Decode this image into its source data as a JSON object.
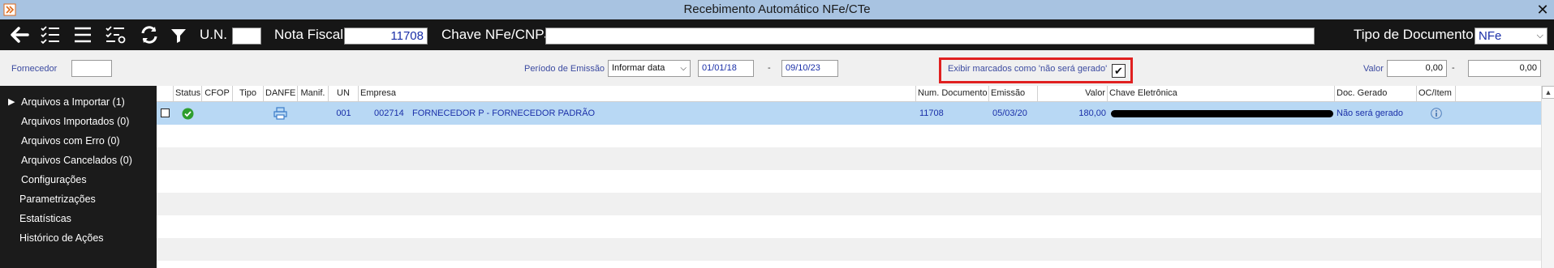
{
  "window": {
    "title": "Recebimento Automático NFe/CTe",
    "close_glyph": "✕"
  },
  "toolbar": {
    "un_label": "U.N.",
    "un_value": "",
    "nota_fiscal_label": "Nota Fiscal",
    "nota_fiscal_value": "11708",
    "chave_label": "Chave NFe/CNPJ",
    "chave_value": "",
    "tipo_doc_label": "Tipo de Documento",
    "tipo_doc_value": "NFe"
  },
  "filters": {
    "fornecedor_label": "Fornecedor",
    "fornecedor_value": "",
    "periodo_label": "Período de Emissão",
    "periodo_option": "Informar data",
    "date_from": "01/01/18",
    "date_sep": "-",
    "date_to": "09/10/23",
    "exibir_label": "Exibir marcados como 'não será gerado'",
    "exibir_checked": true,
    "valor_label": "Valor",
    "valor_from": "0,00",
    "valor_sep": "-",
    "valor_to": "0,00"
  },
  "sidebar": {
    "items": [
      {
        "label": "Arquivos a Importar (1)",
        "expanded": true
      },
      {
        "label": "Arquivos Importados (0)"
      },
      {
        "label": "Arquivos com Erro (0)"
      },
      {
        "label": "Arquivos Cancelados (0)"
      },
      {
        "label": "Configurações"
      },
      {
        "label": "Parametrizações"
      },
      {
        "label": "Estatísticas"
      },
      {
        "label": "Histórico de Ações"
      }
    ]
  },
  "grid": {
    "columns": [
      "Status",
      "CFOP",
      "Tipo",
      "DANFE",
      "Manif.",
      "UN",
      "Empresa",
      "Num. Documento",
      "Emissão",
      "Valor",
      "Chave Eletrônica",
      "Doc. Gerado",
      "OC/Item"
    ],
    "rows": [
      {
        "status": "ok",
        "cfop": "",
        "tipo": "",
        "manif": "",
        "un": "001",
        "empresa_code": "002714",
        "empresa_name": "FORNECEDOR P - FORNECEDOR PADRÃO",
        "num_documento": "11708",
        "emissao": "05/03/20",
        "valor": "180,00",
        "chave": "",
        "doc_gerado": "Não será gerado"
      }
    ]
  },
  "colors": {
    "titlebar": "#a8c3e1",
    "toolbar": "#161616",
    "sidebar": "#1b1b1b",
    "selected_row": "#b8d8f4",
    "stripe": "#f0f0f0",
    "status_ok": "#2e9e2e",
    "highlight_border": "#e02020"
  }
}
